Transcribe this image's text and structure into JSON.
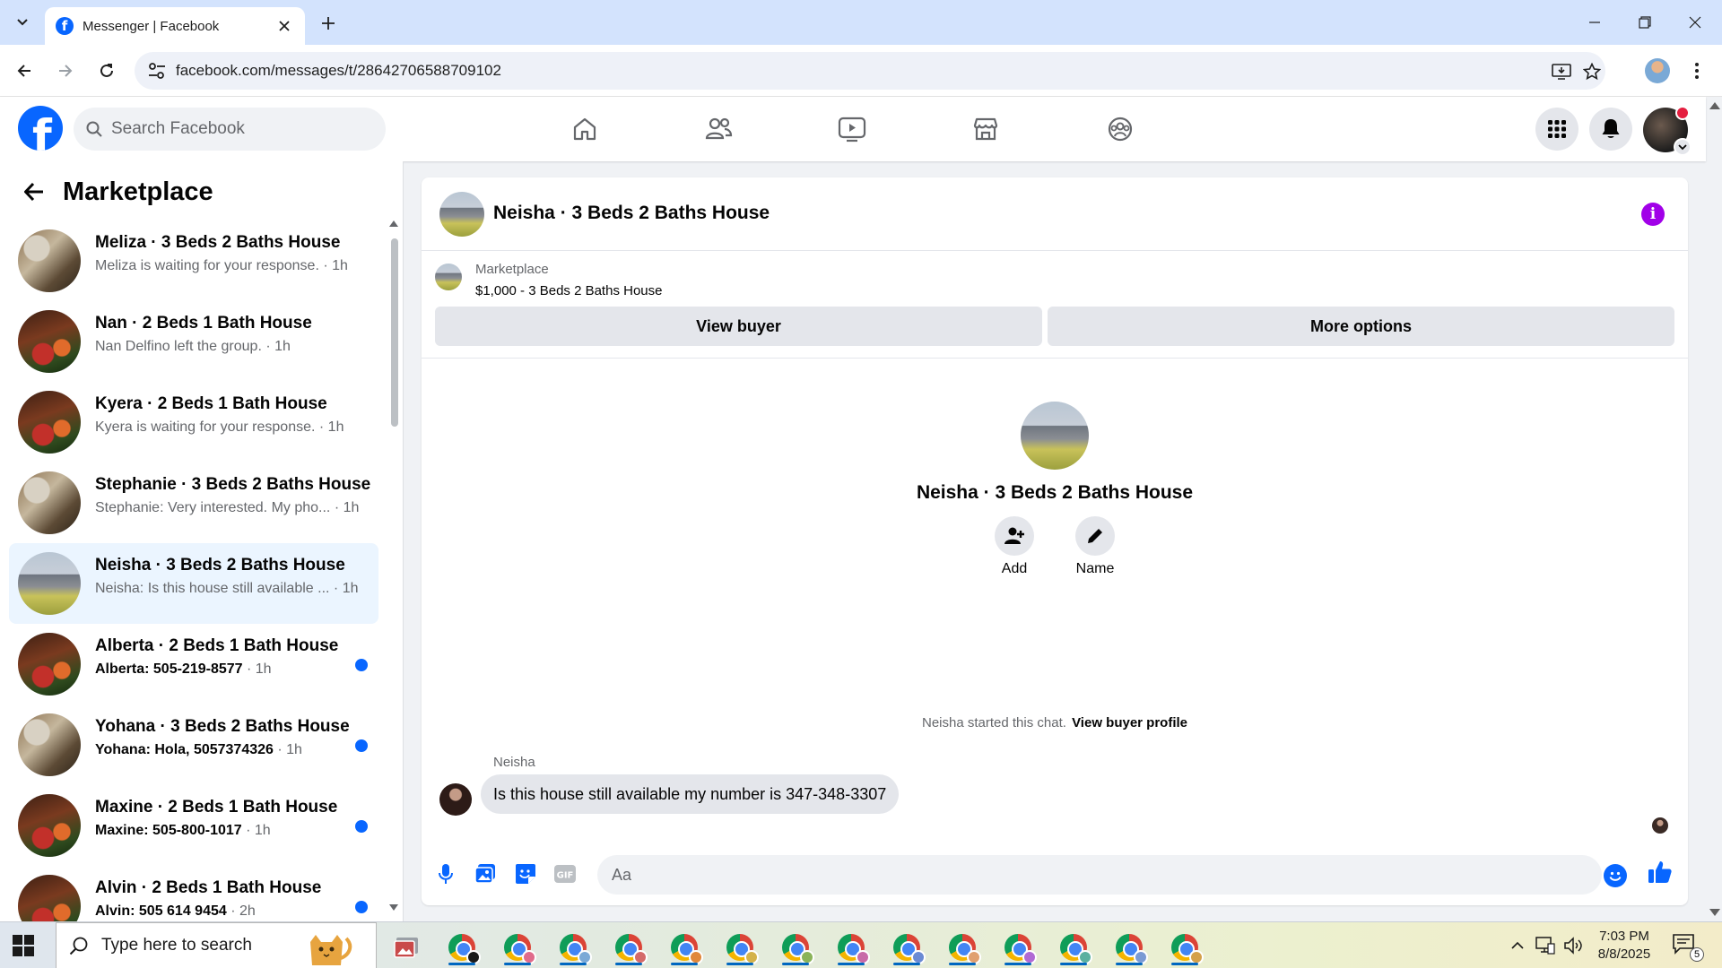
{
  "browser": {
    "tab_title": "Messenger | Facebook",
    "url": "facebook.com/messages/t/28642706588709102"
  },
  "fb": {
    "search_placeholder": "Search Facebook",
    "brand_color": "#0866ff"
  },
  "sidebar": {
    "title": "Marketplace",
    "conversations": [
      {
        "name": "Meliza · 3 Beds 2 Baths House",
        "snippet": "Meliza is waiting for your response.",
        "time": " · 1h",
        "thumb": "kitchen",
        "unread": false,
        "active": false
      },
      {
        "name": "Nan · 2 Beds 1 Bath House",
        "snippet": "Nan Delfino left the group.",
        "time": " · 1h",
        "thumb": "flowers",
        "unread": false,
        "active": false
      },
      {
        "name": "Kyera · 2 Beds 1 Bath House",
        "snippet": "Kyera is waiting for your response.",
        "time": " · 1h",
        "thumb": "flowers",
        "unread": false,
        "active": false
      },
      {
        "name": "Stephanie · 3 Beds 2 Baths House",
        "snippet": "Stephanie: Very interested. My pho...",
        "time": " · 1h",
        "thumb": "kitchen",
        "unread": false,
        "active": false
      },
      {
        "name": "Neisha · 3 Beds 2 Baths House",
        "snippet": "Neisha: Is this house still available ...",
        "time": " · 1h",
        "thumb": "house",
        "unread": false,
        "active": true
      },
      {
        "name": "Alberta · 2 Beds 1 Bath House",
        "snippet": "Alberta: 505-219-8577",
        "time": " · 1h",
        "thumb": "flowers",
        "unread": true,
        "active": false
      },
      {
        "name": "Yohana · 3 Beds 2 Baths House",
        "snippet": "Yohana: Hola, 5057374326",
        "time": " · 1h",
        "thumb": "kitchen",
        "unread": true,
        "active": false
      },
      {
        "name": "Maxine · 2 Beds 1 Bath House",
        "snippet": "Maxine: 505-800-1017",
        "time": " · 1h",
        "thumb": "flowers",
        "unread": true,
        "active": false
      },
      {
        "name": "Alvin · 2 Beds 1 Bath House",
        "snippet": "Alvin: 505 614 9454",
        "time": " · 2h",
        "thumb": "flowers",
        "unread": true,
        "active": false
      }
    ]
  },
  "chat": {
    "title": "Neisha · 3 Beds 2 Baths House",
    "listing_source": "Marketplace",
    "listing_price": "$1,000 - 3 Beds 2 Baths House",
    "view_buyer_label": "View buyer",
    "more_options_label": "More options",
    "intro_name": "Neisha · 3 Beds 2 Baths House",
    "add_label": "Add",
    "name_label": "Name",
    "started_text": "Neisha started this chat.",
    "view_profile_label": "View buyer profile",
    "sender": "Neisha",
    "message": "Is this house still available my number is 347-348-3307",
    "composer_placeholder": "Aa",
    "info_color": "#a100e8"
  },
  "taskbar": {
    "search_placeholder": "Type here to search",
    "time": "7:03 PM",
    "date": "8/8/2025",
    "notification_count": "5"
  }
}
